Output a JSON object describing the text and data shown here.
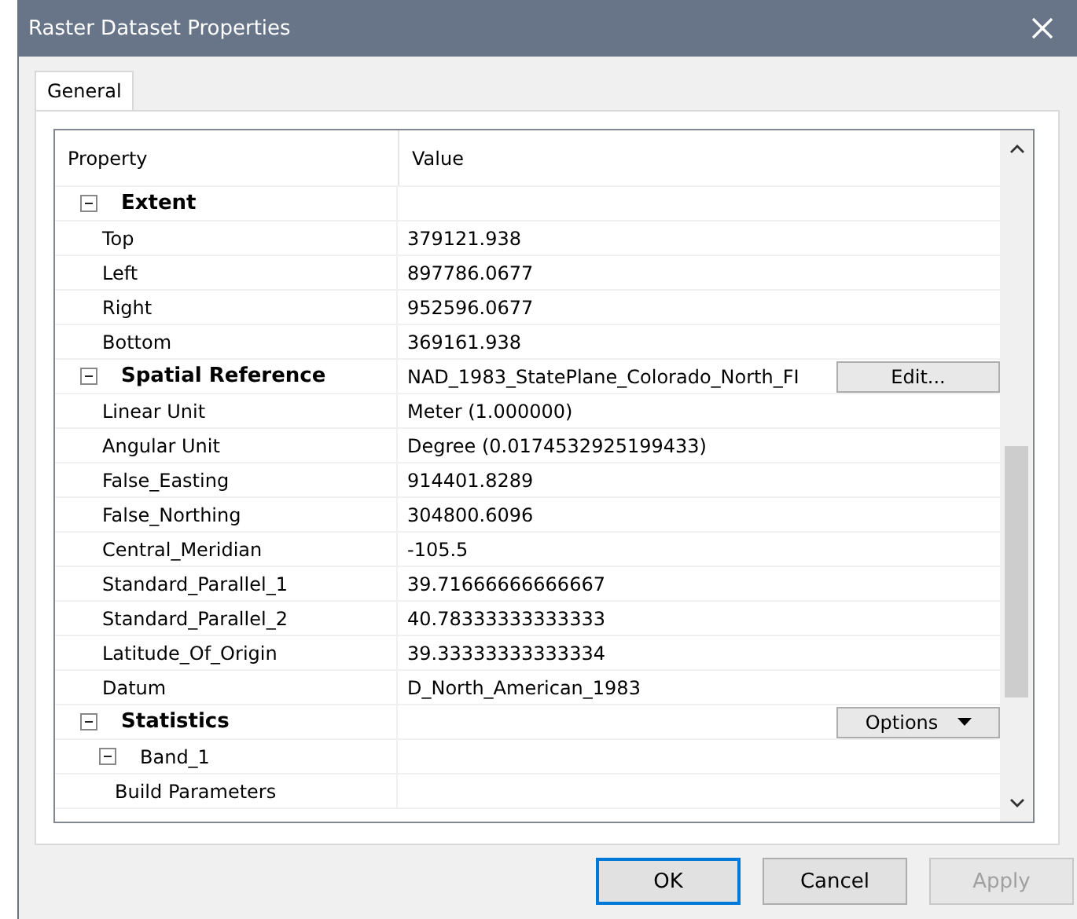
{
  "window": {
    "title": "Raster Dataset Properties"
  },
  "tabs": [
    {
      "label": "General",
      "selected": true
    }
  ],
  "grid": {
    "columns": [
      "Property",
      "Value"
    ],
    "rows": [
      {
        "name": "Extent",
        "bold": true,
        "expanded": true,
        "children": [
          {
            "name": "Top",
            "value": "379121.938"
          },
          {
            "name": "Left",
            "value": "897786.0677"
          },
          {
            "name": "Right",
            "value": "952596.0677"
          },
          {
            "name": "Bottom",
            "value": "369161.938"
          }
        ]
      },
      {
        "name": "Spatial Reference",
        "bold": true,
        "expanded": true,
        "value": "NAD_1983_StatePlane_Colorado_North_FI",
        "button": {
          "label": "Edit...",
          "dropdown": false
        },
        "children": [
          {
            "name": "Linear Unit",
            "value": "Meter (1.000000)"
          },
          {
            "name": "Angular Unit",
            "value": "Degree (0.0174532925199433)"
          },
          {
            "name": "False_Easting",
            "value": "914401.8289"
          },
          {
            "name": "False_Northing",
            "value": "304800.6096"
          },
          {
            "name": "Central_Meridian",
            "value": "-105.5"
          },
          {
            "name": "Standard_Parallel_1",
            "value": "39.71666666666667"
          },
          {
            "name": "Standard_Parallel_2",
            "value": "40.78333333333333"
          },
          {
            "name": "Latitude_Of_Origin",
            "value": "39.33333333333334"
          },
          {
            "name": "Datum",
            "value": "D_North_American_1983"
          }
        ]
      },
      {
        "name": "Statistics",
        "bold": true,
        "expanded": true,
        "button": {
          "label": "Options",
          "dropdown": true
        },
        "children": [
          {
            "name": "Band_1",
            "bold": false,
            "expanded": true,
            "children": [
              {
                "name": "Build Parameters"
              }
            ]
          }
        ]
      }
    ]
  },
  "buttons": [
    {
      "label": "OK",
      "default": true,
      "disabled": false
    },
    {
      "label": "Cancel",
      "default": false,
      "disabled": false
    },
    {
      "label": "Apply",
      "default": false,
      "disabled": true
    }
  ]
}
